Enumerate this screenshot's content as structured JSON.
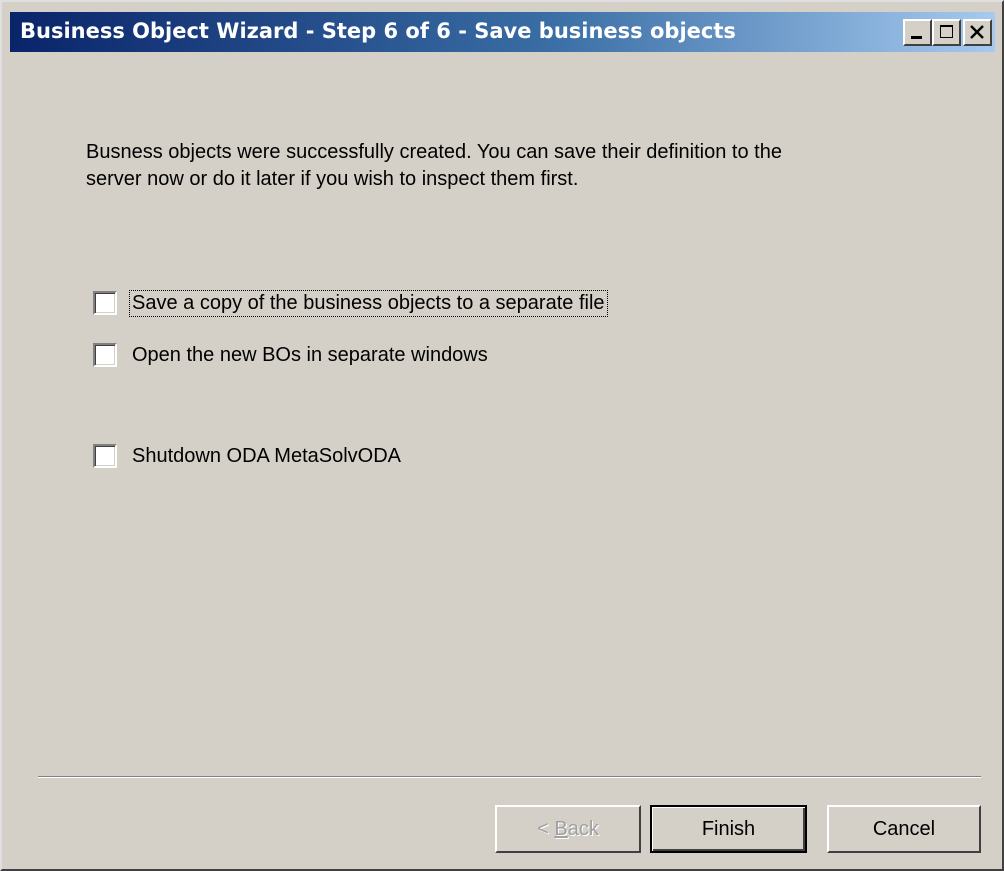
{
  "window": {
    "title": "Business Object Wizard - Step 6 of 6 - Save business objects"
  },
  "caption_buttons": {
    "minimize_icon": "minimize-icon",
    "maximize_icon": "maximize-icon",
    "close_icon": "close-icon"
  },
  "intro": {
    "line1": "Busness objects were successfully created. You can save their definition to the",
    "line2": "server now or do it later if you wish to inspect them first."
  },
  "options": [
    {
      "label": "Save a copy of the business objects to a separate file",
      "checked": false
    },
    {
      "label": "Open the new BOs in separate windows",
      "checked": false
    },
    {
      "label": "Shutdown ODA MetaSolvODA",
      "checked": false
    }
  ],
  "buttons": {
    "back": {
      "label_mnemonic": "B",
      "label_rest": "ack",
      "prefix": "< ",
      "enabled": false
    },
    "finish": {
      "label": "Finish"
    },
    "cancel": {
      "label": "Cancel"
    }
  },
  "colors": {
    "face": "#d4d0c8",
    "title_start": "#0a246a",
    "title_end": "#a6caf0",
    "disabled_text": "#a0a0a0"
  }
}
